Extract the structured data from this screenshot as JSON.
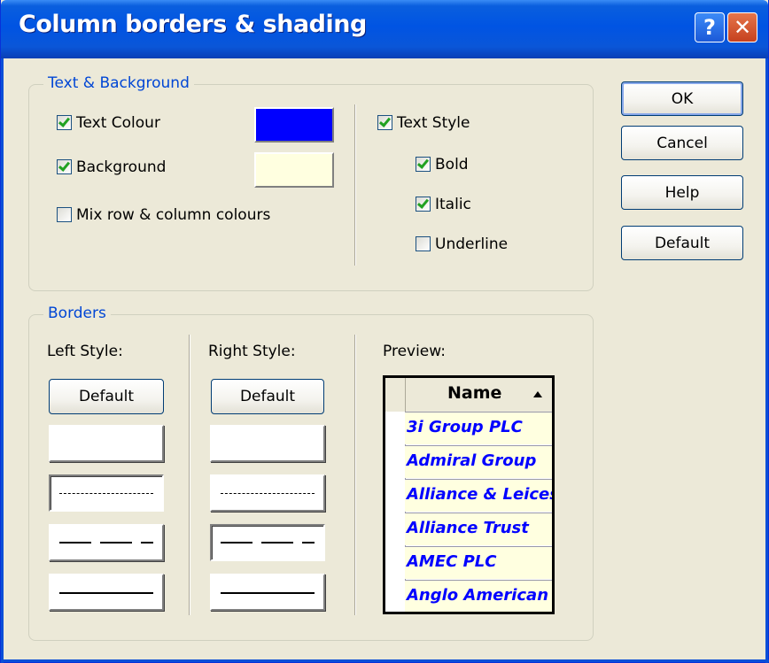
{
  "window": {
    "title": "Column borders & shading",
    "help_glyph": "?",
    "close_glyph": "✕"
  },
  "text_background": {
    "group_title": "Text & Background",
    "text_colour": {
      "label": "Text Colour",
      "checked": true,
      "swatch": "#0000ff"
    },
    "background": {
      "label": "Background",
      "checked": true,
      "swatch": "#ffffe0"
    },
    "mix_colours": {
      "label": "Mix row & column colours",
      "checked": false
    },
    "text_style": {
      "label": "Text Style",
      "checked": true
    },
    "bold": {
      "label": "Bold",
      "checked": true
    },
    "italic": {
      "label": "Italic",
      "checked": true
    },
    "underline": {
      "label": "Underline",
      "checked": false
    }
  },
  "borders": {
    "group_title": "Borders",
    "left_style_label": "Left Style:",
    "right_style_label": "Right Style:",
    "preview_label": "Preview:",
    "default_label": "Default",
    "left_styles": [
      "none",
      "dotted",
      "dashed",
      "solid"
    ],
    "right_styles": [
      "none",
      "dotted",
      "dashed",
      "solid"
    ],
    "left_selected": "dotted",
    "right_selected": "dashed"
  },
  "preview": {
    "column_header": "Name",
    "sort_direction": "ascending",
    "rows": [
      "3i Group PLC",
      "Admiral Group",
      "Alliance & Leicester",
      "Alliance Trust",
      "AMEC PLC",
      "Anglo American"
    ]
  },
  "buttons": {
    "ok": "OK",
    "cancel": "Cancel",
    "help": "Help",
    "default": "Default"
  },
  "colors": {
    "title_bar": "#0054e3",
    "dialog_bg": "#ece9d8",
    "group_title": "#0046d5",
    "preview_text": "#0000ff",
    "preview_bg": "#ffffe0"
  }
}
